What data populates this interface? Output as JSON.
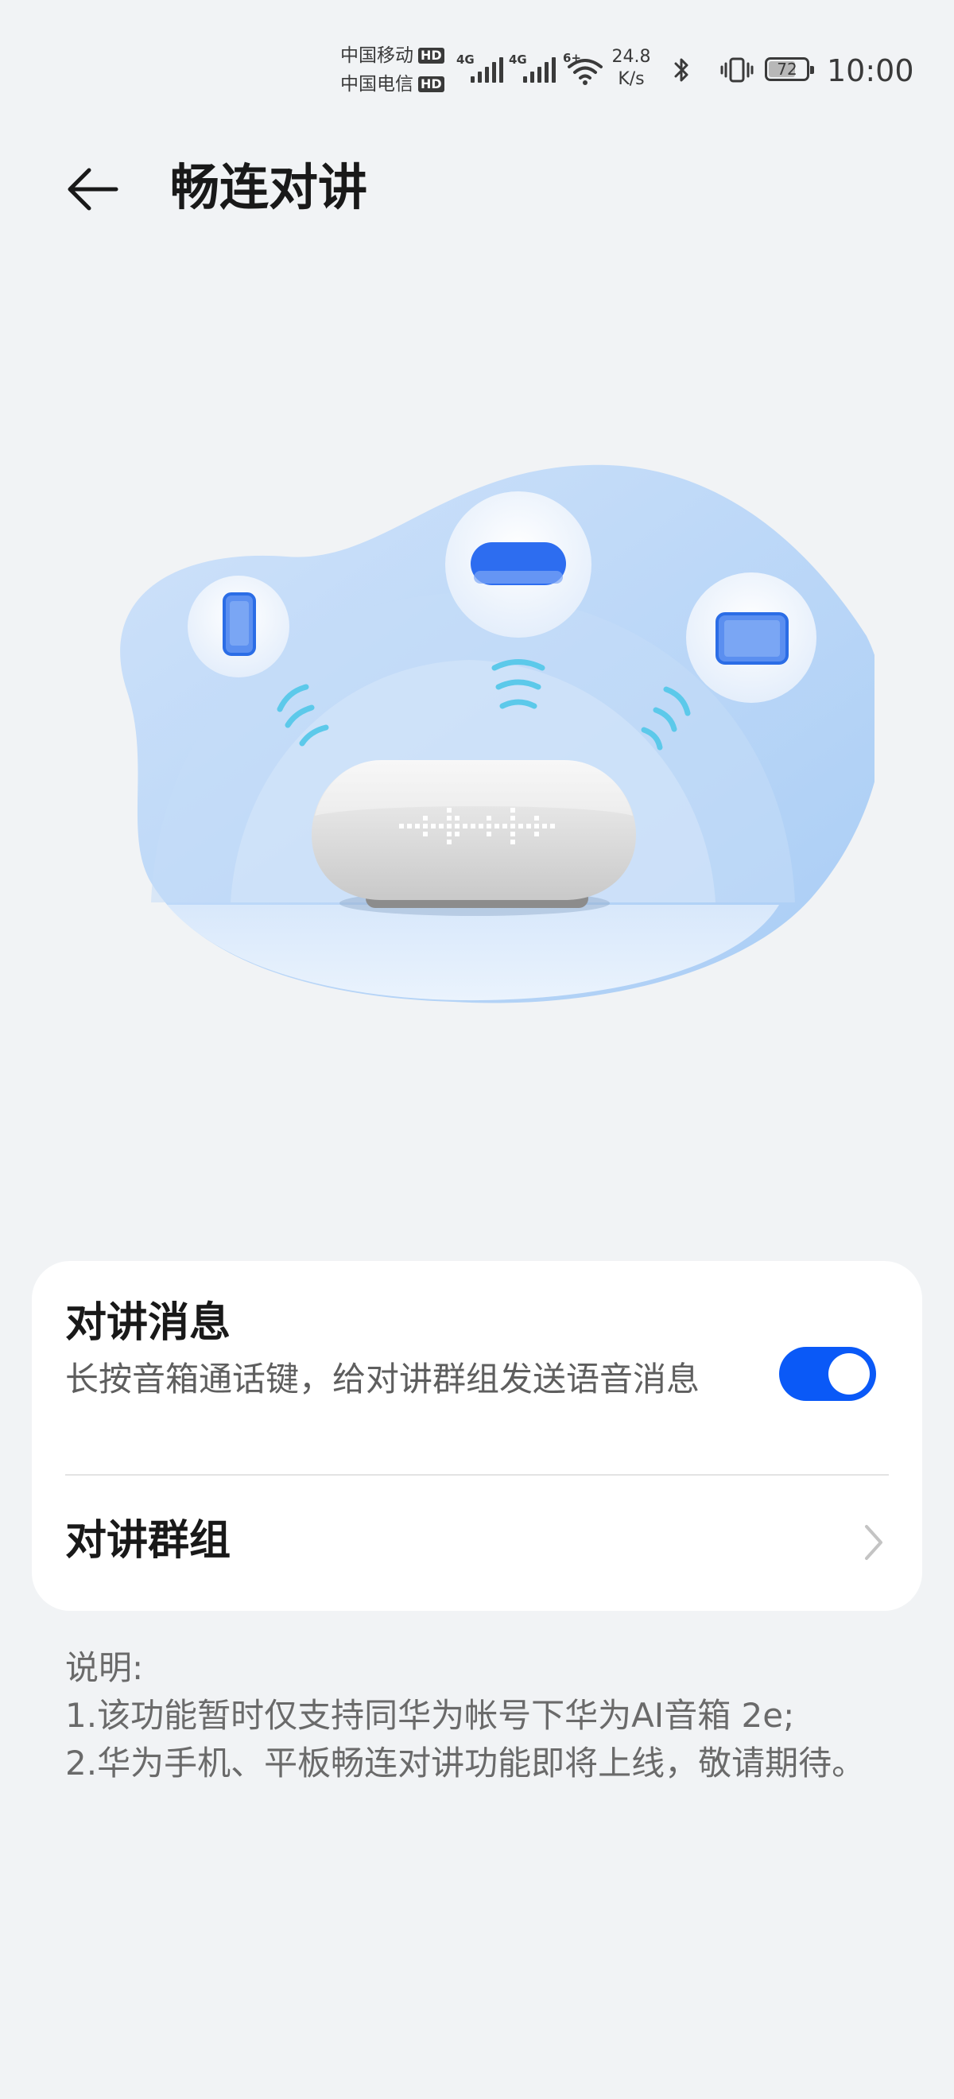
{
  "status_bar": {
    "carrier_1": "中国移动",
    "carrier_2": "中国电信",
    "hd_badge": "HD",
    "sim1_network": "4G",
    "sim2_network": "4G",
    "wifi_tag": "6+",
    "net_speed_value": "24.8",
    "net_speed_unit": "K/s",
    "battery_percent": "72",
    "battery_level": 0.72,
    "time": "10:00",
    "icons": [
      "signal-icon",
      "wifi-icon",
      "bluetooth-icon",
      "vibrate-icon",
      "battery-icon"
    ]
  },
  "header": {
    "back_icon": "back-arrow-icon",
    "title": "畅连对讲"
  },
  "intercom_message": {
    "title": "对讲消息",
    "description": "长按音箱通话键，给对讲群组发送语音消息",
    "toggle_on": true
  },
  "intercom_group": {
    "label": "对讲群组",
    "chevron_icon": "chevron-right-icon"
  },
  "notes": {
    "heading": "说明:",
    "line1": "1.该功能暂时仅支持同华为帐号下华为AI音箱 2e;",
    "line2": "2.华为手机、平板畅连对讲功能即将上线，敬请期待。"
  },
  "colors": {
    "background": "#f1f3f5",
    "accent": "#0a59f7",
    "card": "#ffffff",
    "illustration_blue": "#b9d6f7"
  }
}
